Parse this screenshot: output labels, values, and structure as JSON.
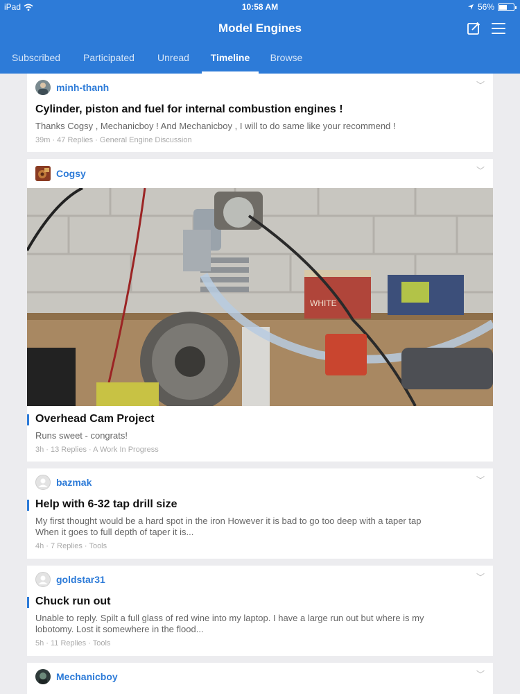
{
  "status_bar": {
    "carrier": "iPad",
    "time": "10:58 AM",
    "battery": "56%",
    "battery_level": 0.56
  },
  "header": {
    "title": "Model Engines"
  },
  "tabs": [
    {
      "label": "Subscribed"
    },
    {
      "label": "Participated"
    },
    {
      "label": "Unread"
    },
    {
      "label": "Timeline",
      "active": true
    },
    {
      "label": "Browse"
    }
  ],
  "posts": [
    {
      "user": "minh-thanh",
      "title": "Cylinder, piston and fuel for  internal combustion engines !",
      "excerpt": "Thanks Cogsy , Mechanicboy ! And Mechanicboy , I will to do same like your recommend !",
      "meta": "39m · 47 Replies · General Engine Discussion"
    },
    {
      "user": "Cogsy",
      "title": "Overhead Cam Project",
      "excerpt": "Runs sweet - congrats!",
      "meta": "3h · 13 Replies · A Work In Progress",
      "photo_label": "WHITE"
    },
    {
      "user": "bazmak",
      "title": "Help with 6-32 tap drill size",
      "excerpt_line1": "My first thought would be a hard spot in the iron However it is bad to go too deep with a taper tap",
      "excerpt_line2": "When it goes to full depth of taper it is...",
      "meta": "4h · 7 Replies · Tools"
    },
    {
      "user": "goldstar31",
      "title": "Chuck run out",
      "excerpt_line1": "Unable to reply. Spilt a full glass of red wine into my laptop. I have a large run out but where is my",
      "excerpt_line2": "lobotomy. Lost it somewhere in the flood...",
      "meta": "5h · 11 Replies · Tools"
    },
    {
      "user": "Mechanicboy"
    }
  ]
}
